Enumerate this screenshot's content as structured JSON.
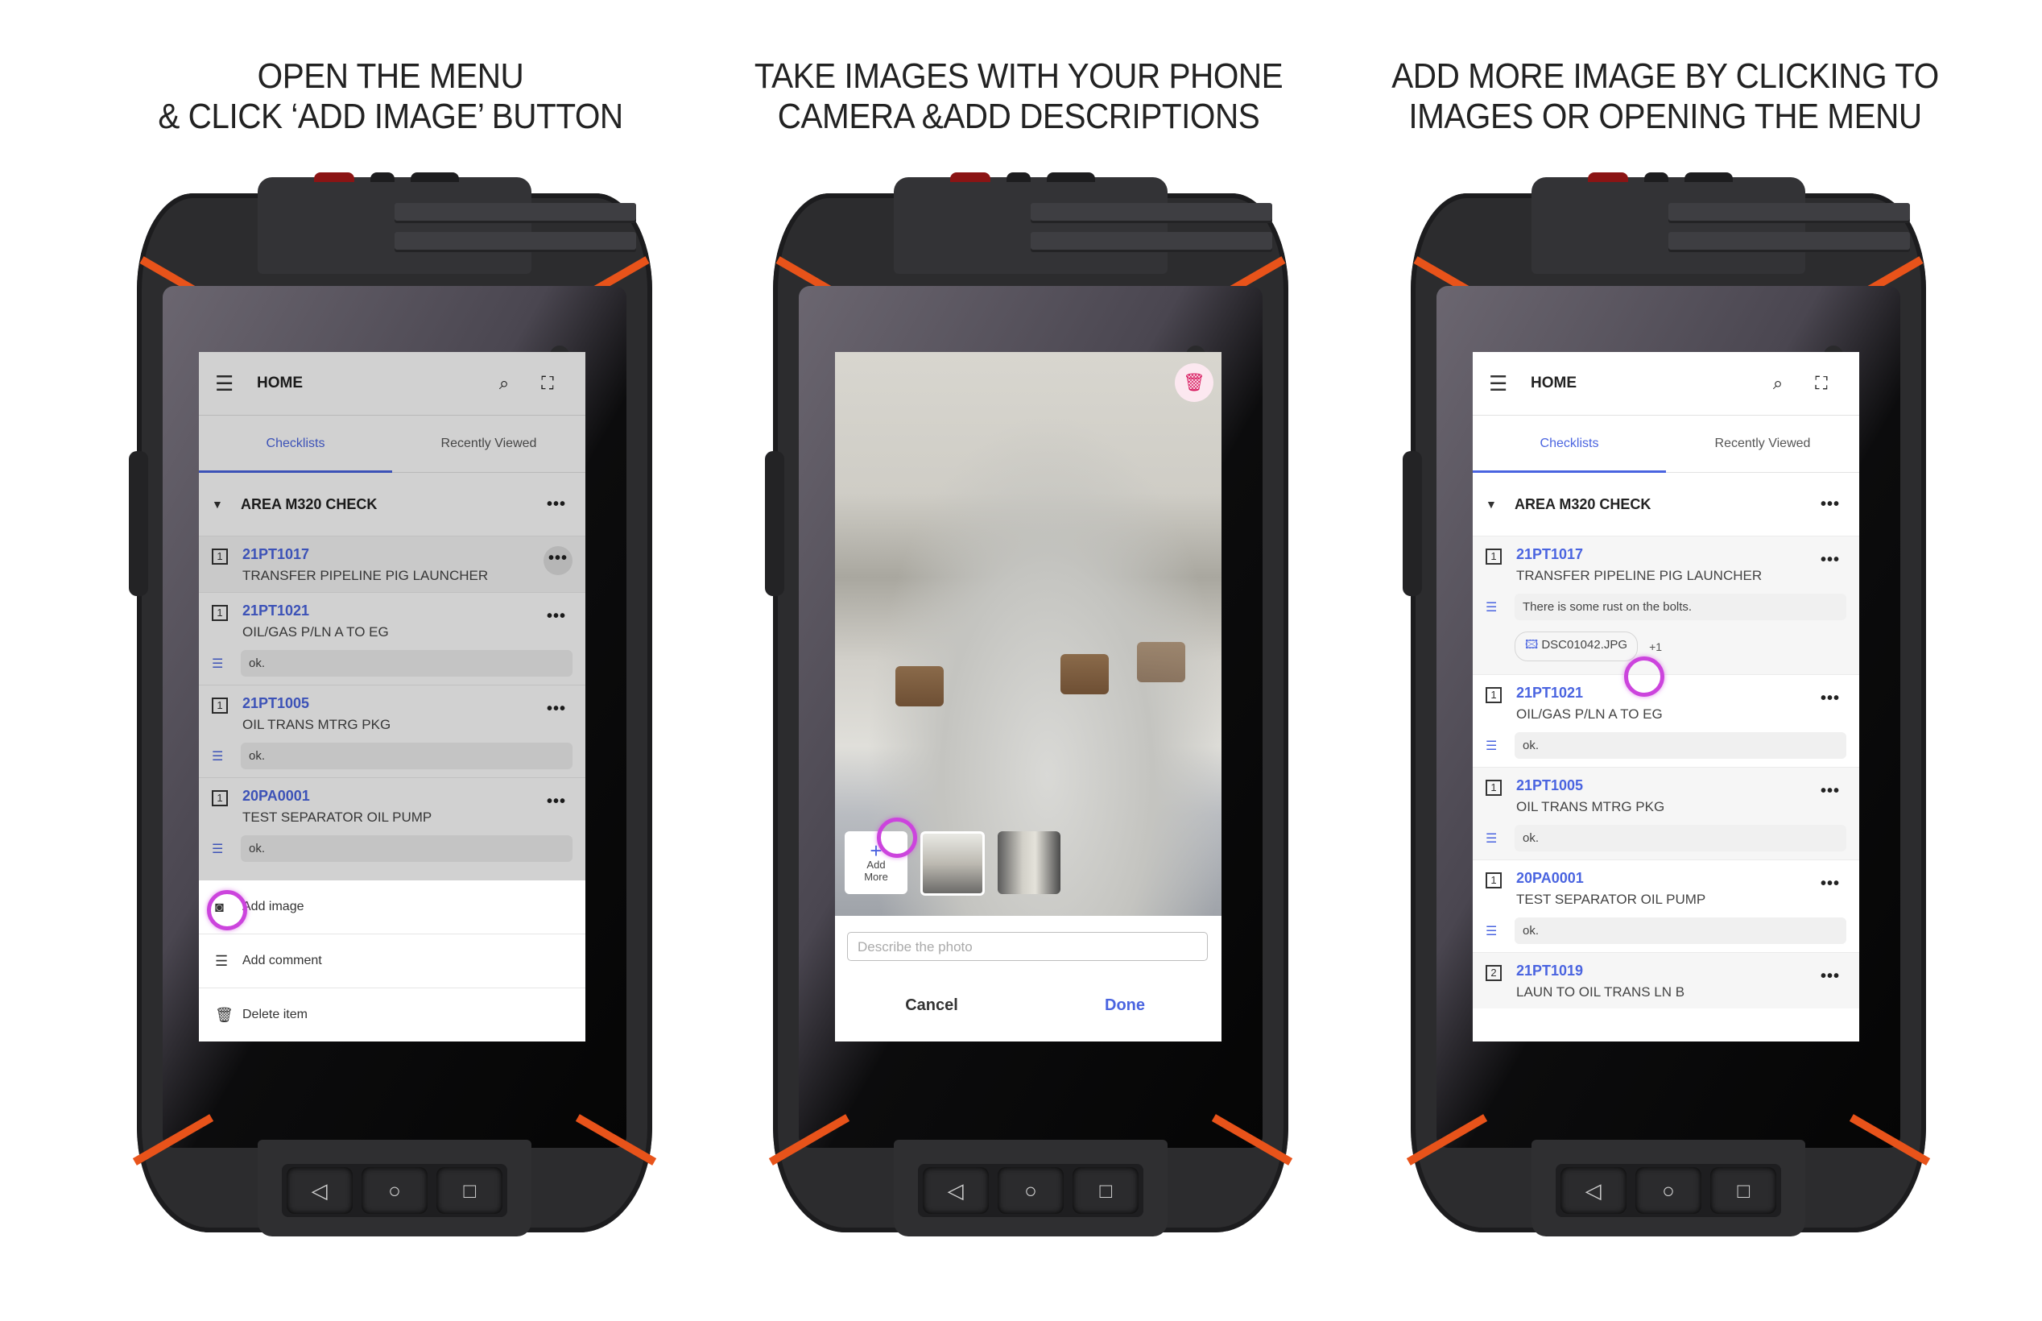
{
  "steps": [
    {
      "title_lines": [
        "OPEN THE MENU",
        "& CLICK ‘ADD IMAGE’ BUTTON"
      ]
    },
    {
      "title_lines": [
        "TAKE IMAGES WITH YOUR PHONE",
        "CAMERA &ADD DESCRIPTIONS"
      ]
    },
    {
      "title_lines": [
        "ADD MORE IMAGE BY CLICKING TO",
        "IMAGES OR OPENING THE MENU"
      ]
    }
  ],
  "app": {
    "title": "HOME",
    "icons": {
      "menu": "☰",
      "search": "⌕",
      "scan": "⛶",
      "more": "•••",
      "caret": "▼",
      "comment": "☰",
      "image": "🖾"
    },
    "tabs": [
      {
        "label": "Checklists",
        "active": true
      },
      {
        "label": "Recently Viewed",
        "active": false
      }
    ],
    "section_title": "AREA M320 CHECK",
    "accent": "#4a64e0",
    "highlight": "#cc44dd"
  },
  "screen1": {
    "items": [
      {
        "num": "1",
        "code": "21PT1017",
        "desc": "TRANSFER PIPELINE PIG LAUNCHER"
      },
      {
        "num": "1",
        "code": "21PT1021",
        "desc": "OIL/GAS P/LN A TO EG",
        "comment": "ok."
      },
      {
        "num": "1",
        "code": "21PT1005",
        "desc": "OIL TRANS MTRG PKG",
        "comment": "ok."
      },
      {
        "num": "1",
        "code": "20PA0001",
        "desc": "TEST SEPARATOR OIL PUMP",
        "comment": "ok."
      }
    ],
    "menu": [
      {
        "icon": "camera-icon",
        "glyph": "◙",
        "label": "Add image"
      },
      {
        "icon": "comment-icon",
        "glyph": "☰",
        "label": "Add comment"
      },
      {
        "icon": "trash-icon",
        "glyph": "🗑",
        "label": "Delete item"
      }
    ]
  },
  "screen2": {
    "trash_glyph": "🗑",
    "add_more": {
      "plus": "+",
      "line1": "Add",
      "line2": "More"
    },
    "description_placeholder": "Describe the photo",
    "cancel_label": "Cancel",
    "done_label": "Done"
  },
  "screen3": {
    "items": [
      {
        "num": "1",
        "code": "21PT1017",
        "desc": "TRANSFER PIPELINE PIG LAUNCHER",
        "comment": "There is some rust on the bolts.",
        "attachment": "DSC01042.JPG",
        "more_count": "+1"
      },
      {
        "num": "1",
        "code": "21PT1021",
        "desc": "OIL/GAS P/LN A TO EG",
        "comment": "ok."
      },
      {
        "num": "1",
        "code": "21PT1005",
        "desc": "OIL TRANS MTRG PKG",
        "comment": "ok."
      },
      {
        "num": "1",
        "code": "20PA0001",
        "desc": "TEST SEPARATOR OIL PUMP",
        "comment": "ok."
      },
      {
        "num": "2",
        "code": "21PT1019",
        "desc": "LAUN TO OIL TRANS LN B"
      }
    ]
  },
  "nav": {
    "back": "◁",
    "home": "○",
    "recent": "□"
  }
}
